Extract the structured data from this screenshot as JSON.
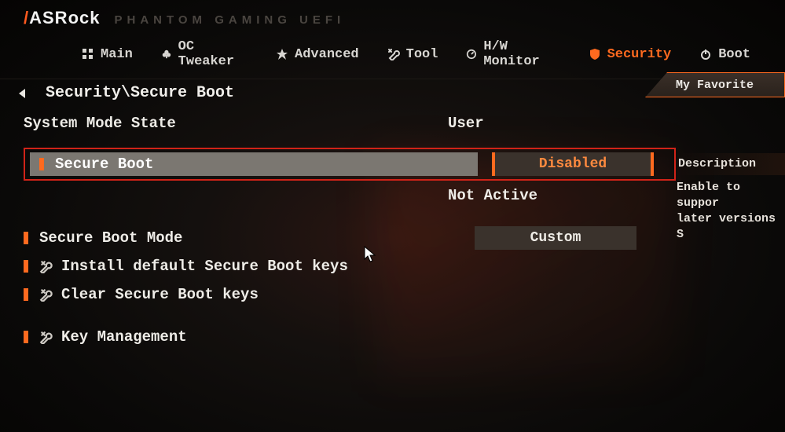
{
  "brand": {
    "logo_left": "ASR",
    "logo_right": "ock",
    "subtitle": "PHANTOM GAMING UEFI"
  },
  "nav": {
    "items": [
      {
        "label": "Main"
      },
      {
        "label": "OC Tweaker"
      },
      {
        "label": "Advanced"
      },
      {
        "label": "Tool"
      },
      {
        "label": "H/W Monitor"
      },
      {
        "label": "Security"
      },
      {
        "label": "Boot"
      }
    ],
    "active_index": 5
  },
  "breadcrumb": "Security\\Secure Boot",
  "favorite_label": "My Favorite",
  "rows": {
    "system_mode_state": {
      "label": "System Mode State",
      "value": "User"
    },
    "secure_boot": {
      "label": "Secure Boot",
      "value": "Disabled",
      "status": "Not Active"
    },
    "secure_boot_mode": {
      "label": "Secure Boot Mode",
      "value": "Custom"
    },
    "install_keys": {
      "label": "Install default Secure Boot keys"
    },
    "clear_keys": {
      "label": "Clear Secure Boot keys"
    },
    "key_mgmt": {
      "label": "Key Management"
    }
  },
  "description": {
    "title": "Description",
    "body_line1": "Enable to suppor",
    "body_line2": "later versions S"
  }
}
